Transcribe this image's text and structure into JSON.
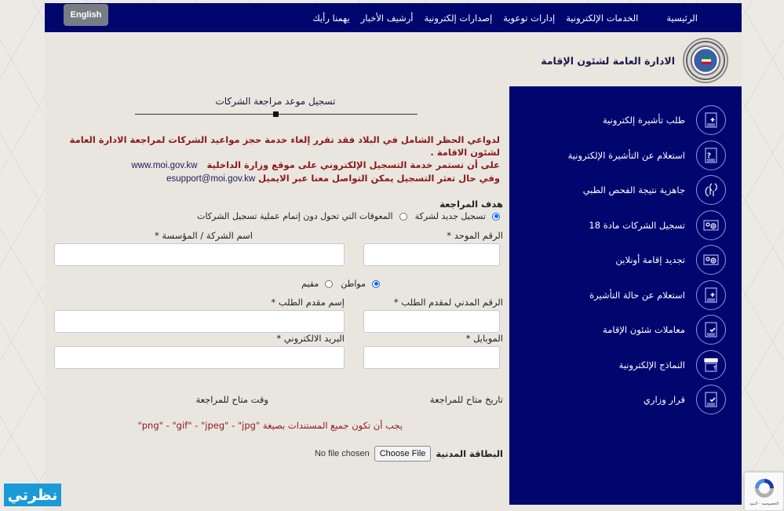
{
  "nav": {
    "language_button": "English",
    "items": [
      {
        "label": "الرئيسية"
      },
      {
        "label": "الخدمات الإلكترونية"
      },
      {
        "label": "إدارات توعوية"
      },
      {
        "label": "إصدارات إلكترونية"
      },
      {
        "label": "أرشيف الأخبار"
      },
      {
        "label": "يهمنا رأيك"
      }
    ]
  },
  "brand": {
    "title": "الادارة العامة لشئون الإقامة"
  },
  "sidebar": {
    "items": [
      {
        "label": "طلب تأشيرة إلكترونية",
        "icon": "document-plus-icon"
      },
      {
        "label": "استعلام عن التأشيرة الإلكترونية",
        "icon": "document-question-icon"
      },
      {
        "label": "جاهزية نتيجة الفحص الطبي",
        "icon": "stethoscope-icon"
      },
      {
        "label": "تسجيل الشركات مادة 18",
        "icon": "card-gear-icon"
      },
      {
        "label": "تجديد إقامة أونلاين",
        "icon": "card-gear-icon"
      },
      {
        "label": "استعلام عن حالة التأشيرة",
        "icon": "document-plus-icon"
      },
      {
        "label": "معاملات شئون الإقامة",
        "icon": "document-check-icon"
      },
      {
        "label": "النماذج الإلكترونية",
        "icon": "eforms-icon"
      },
      {
        "label": "قرار وزاري",
        "icon": "document-check-icon"
      }
    ]
  },
  "form": {
    "title": "تسجيل موعد مراجعة الشركات",
    "notice": {
      "line1": "لدواعي الحظر الشامل في البلاد فقد تقرر إلغاء خدمة حجز مواعيد الشركات لمراجعة الادارة العامة لشئون الاقامة .",
      "line2_text": "على أن تستمر خدمة التسجيل الإلكتروني على موقع وزارة الداخلية",
      "line2_link": "www.moi.gov.kw",
      "line3_text": "وفي حال تعثر التسجيل يمكن التواصل معنا عبر الايميل",
      "line3_link": "esupport@moi.gov.kw"
    },
    "purpose_label": "هدف المراجعة",
    "purpose_options": [
      {
        "label": "تسجيل جديد لشركة",
        "selected": true
      },
      {
        "label": "المعوقات التي تحول دون إتمام عملية تسجيل الشركات",
        "selected": false
      }
    ],
    "unified_number_label": "الرقم الموحد *",
    "unified_number_value": "",
    "company_name_label": "اسم الشركة / المؤسسة *",
    "company_name_value": "",
    "applicant_type_options": [
      {
        "label": "مواطن",
        "selected": true
      },
      {
        "label": "مقيم",
        "selected": false
      }
    ],
    "civil_id_label": "الرقم المدني لمقدم الطلب *",
    "civil_id_value": "",
    "applicant_name_label": "إسم مقدم الطلب *",
    "applicant_name_value": "",
    "mobile_label": "الموبايل *",
    "mobile_value": "",
    "email_label": "البريد الالكتروني *",
    "email_value": "",
    "available_date_label": "تاريخ متاح للمراجعة",
    "available_time_label": "وقت متاح للمراجعة",
    "formats_notice": "يجب أن تكون جميع المستندات بصيغة \"png\" - \"gif\" - \"jpeg\" - \"jpg\"",
    "civil_card_label": "البطاقة المدنية",
    "choose_file_button": "Choose File",
    "no_file_text": "No file chosen"
  },
  "watermark": {
    "text": "نظرتي"
  },
  "recaptcha": {
    "caption": "الخصوصية - البنود"
  }
}
